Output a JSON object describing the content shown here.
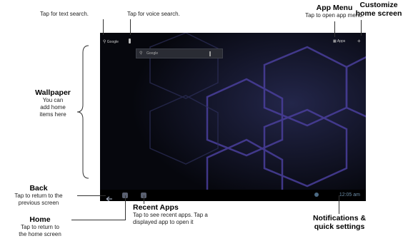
{
  "screen": {
    "top_left_search_text": "Google",
    "apps_label": "Apps",
    "search_bar_placeholder": "Google",
    "clock": "12:05 am"
  },
  "callouts": {
    "text_search": "Tap for text search.",
    "voice_search": "Tap for voice search.",
    "app_menu": {
      "title": "App Menu",
      "desc": "Tap to open app menu."
    },
    "customize": {
      "title_1": "Customize",
      "title_2": "home screen"
    },
    "wallpaper": {
      "title": "Wallpaper",
      "desc_1": "You can",
      "desc_2": "add home",
      "desc_3": "items here"
    },
    "back": {
      "title": "Back",
      "desc_1": "Tap to return to the",
      "desc_2": "previous screen"
    },
    "home": {
      "title": "Home",
      "desc_1": "Tap to return to",
      "desc_2": "the home screen"
    },
    "recent_apps": {
      "title": "Recent Apps",
      "desc_1": "Tap to see recent apps. Tap a",
      "desc_2": "displayed app to open it"
    },
    "notifications": {
      "title_1": "Notifications &",
      "title_2": "quick settings"
    }
  },
  "icons": [
    "search-icon",
    "mic-icon",
    "apps-grid-icon",
    "plus-icon",
    "back-icon",
    "home-icon",
    "recent-apps-icon",
    "wifi-icon",
    "battery-icon"
  ]
}
